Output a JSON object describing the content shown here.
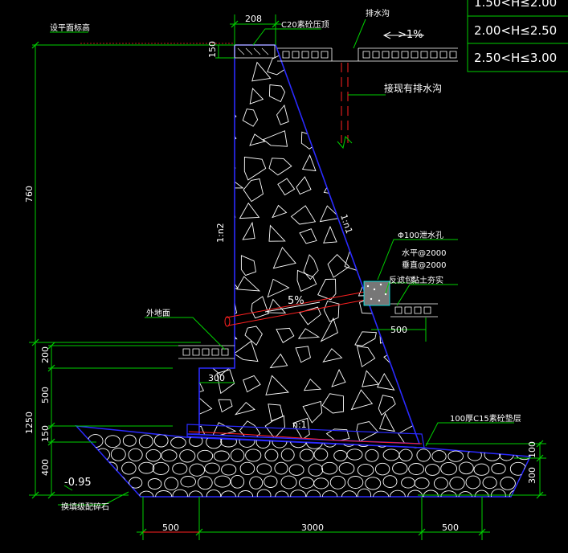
{
  "drawing": {
    "labels": {
      "design_ground": "设平面标高",
      "c20_cap": "C20素砼压顶",
      "drain_ditch": "排水沟",
      "slope_1pct": ">1%",
      "connect_existing": "接现有排水沟",
      "batter_left": "1:n2",
      "batter_right": "1:n1",
      "weep_hole": "Φ100泄水孔",
      "weep_h": "水平@2000",
      "weep_v": "垂直@2000",
      "filter_pack": "反滤包",
      "clay_seal": "黏土夯实",
      "outer_ground": "外地面",
      "slope_5pct": "5%",
      "base_ratio": "n:1",
      "cushion": "100厚C15素砼垫层",
      "foundation_stone": "换填级配碎石",
      "elevation": "-0.95"
    },
    "dimensions": {
      "top_width": "208",
      "cap_height": "150",
      "height_760": "760",
      "d200": "200",
      "d500v": "500",
      "d1250": "1250",
      "d150": "150",
      "d400": "400",
      "d300_toe": "300",
      "d500_drain": "500",
      "d100": "100",
      "d300_right": "300",
      "base_left": "500",
      "base_mid": "3000",
      "base_right": "500"
    },
    "table": {
      "rows": [
        "1.50<H≤2.00",
        "2.00<H≤2.50",
        "2.50<H≤3.00"
      ]
    },
    "colors": {
      "outline": "#2a2aff",
      "dimension": "#00d000",
      "leader": "#00d000",
      "red": "#ff2020",
      "fill_lines": "#ffffff",
      "background": "#000000"
    }
  }
}
